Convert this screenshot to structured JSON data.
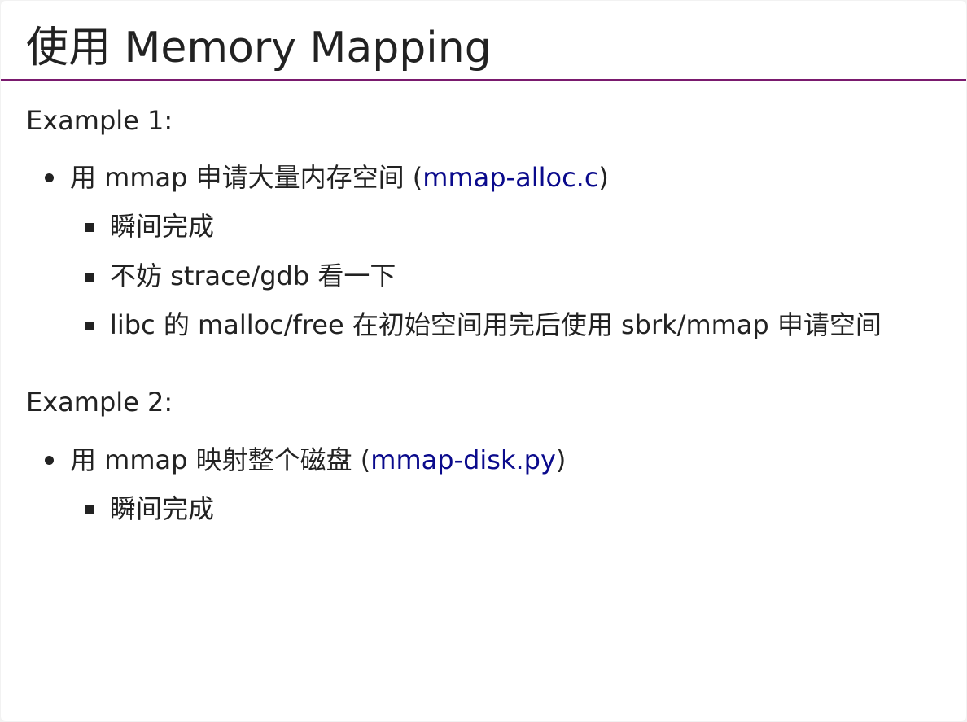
{
  "title": "使用 Memory Mapping",
  "colors": {
    "title_rule": "#7a1a6e",
    "link": "#0a0a8c",
    "text": "#222222"
  },
  "examples": [
    {
      "heading": "Example 1:",
      "bullet": {
        "text": "用 mmap 申请大量内存空间 (",
        "link": "mmap-alloc.c",
        "suffix": ")"
      },
      "subitems": [
        "瞬间完成",
        "不妨 strace/gdb 看一下",
        "libc 的 malloc/free 在初始空间用完后使用 sbrk/mmap 申请空间"
      ]
    },
    {
      "heading": "Example 2:",
      "bullet": {
        "text": "用 mmap 映射整个磁盘 (",
        "link": "mmap-disk.py",
        "suffix": ")"
      },
      "subitems": [
        "瞬间完成"
      ]
    }
  ]
}
